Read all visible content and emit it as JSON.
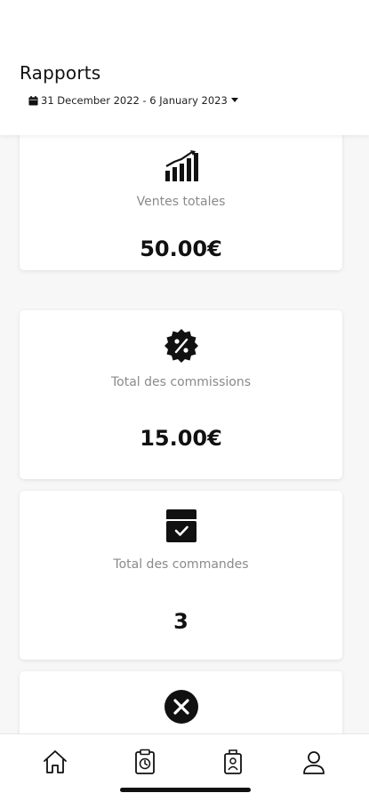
{
  "header": {
    "title": "Rapports",
    "date_range": "31 December 2022 - 6 January 2023"
  },
  "cards": [
    {
      "icon": "bar-chart-icon",
      "label": "Ventes totales",
      "value": "50.00€"
    },
    {
      "icon": "percent-badge-icon",
      "label": "Total des commissions",
      "value": "15.00€"
    },
    {
      "icon": "box-check-icon",
      "label": "Total des commandes",
      "value": "3"
    },
    {
      "icon": "cancel-circle-icon",
      "label": "",
      "value": ""
    }
  ],
  "tabbar": {
    "items": [
      {
        "icon": "home-icon"
      },
      {
        "icon": "clipboard-icon"
      },
      {
        "icon": "badge-icon"
      },
      {
        "icon": "user-icon"
      }
    ]
  },
  "colors": {
    "background": "#f7f7f7",
    "card": "#ffffff",
    "text": "#111111",
    "muted_label": "#8a8a8a"
  }
}
